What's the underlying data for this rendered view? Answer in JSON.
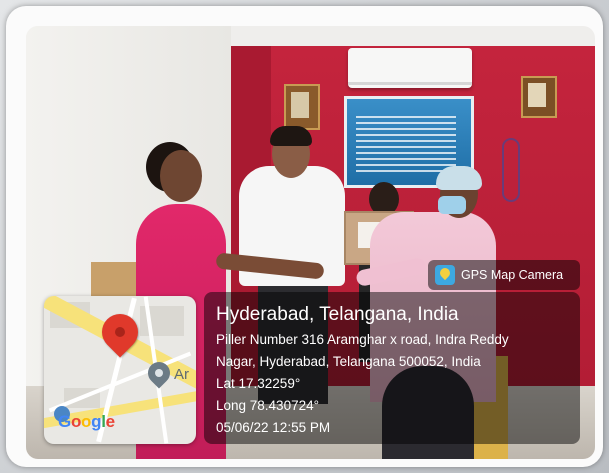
{
  "gps": {
    "app_label": "GPS Map Camera",
    "app_icon": "gps-map-camera-icon",
    "title": "Hyderabad, Telangana, India",
    "address_line1": "Piller Number 316 Aramghar x road, Indra Reddy",
    "address_line2": "Nagar, Hyderabad, Telangana 500052, India",
    "lat": "Lat 17.32259°",
    "long": "Long 78.430724°",
    "datetime": "05/06/22 12:55 PM"
  },
  "map": {
    "place_label": "Ar",
    "brand": [
      "G",
      "o",
      "o",
      "g",
      "l",
      "e"
    ],
    "pin_icon": "map-pin-icon",
    "place_icon": "place-marker-icon",
    "street_view_icon": "street-view-icon"
  },
  "colors": {
    "wall": "#c4243d",
    "overlay": "rgba(0,0,0,0.48)",
    "pin": "#e0392b"
  }
}
